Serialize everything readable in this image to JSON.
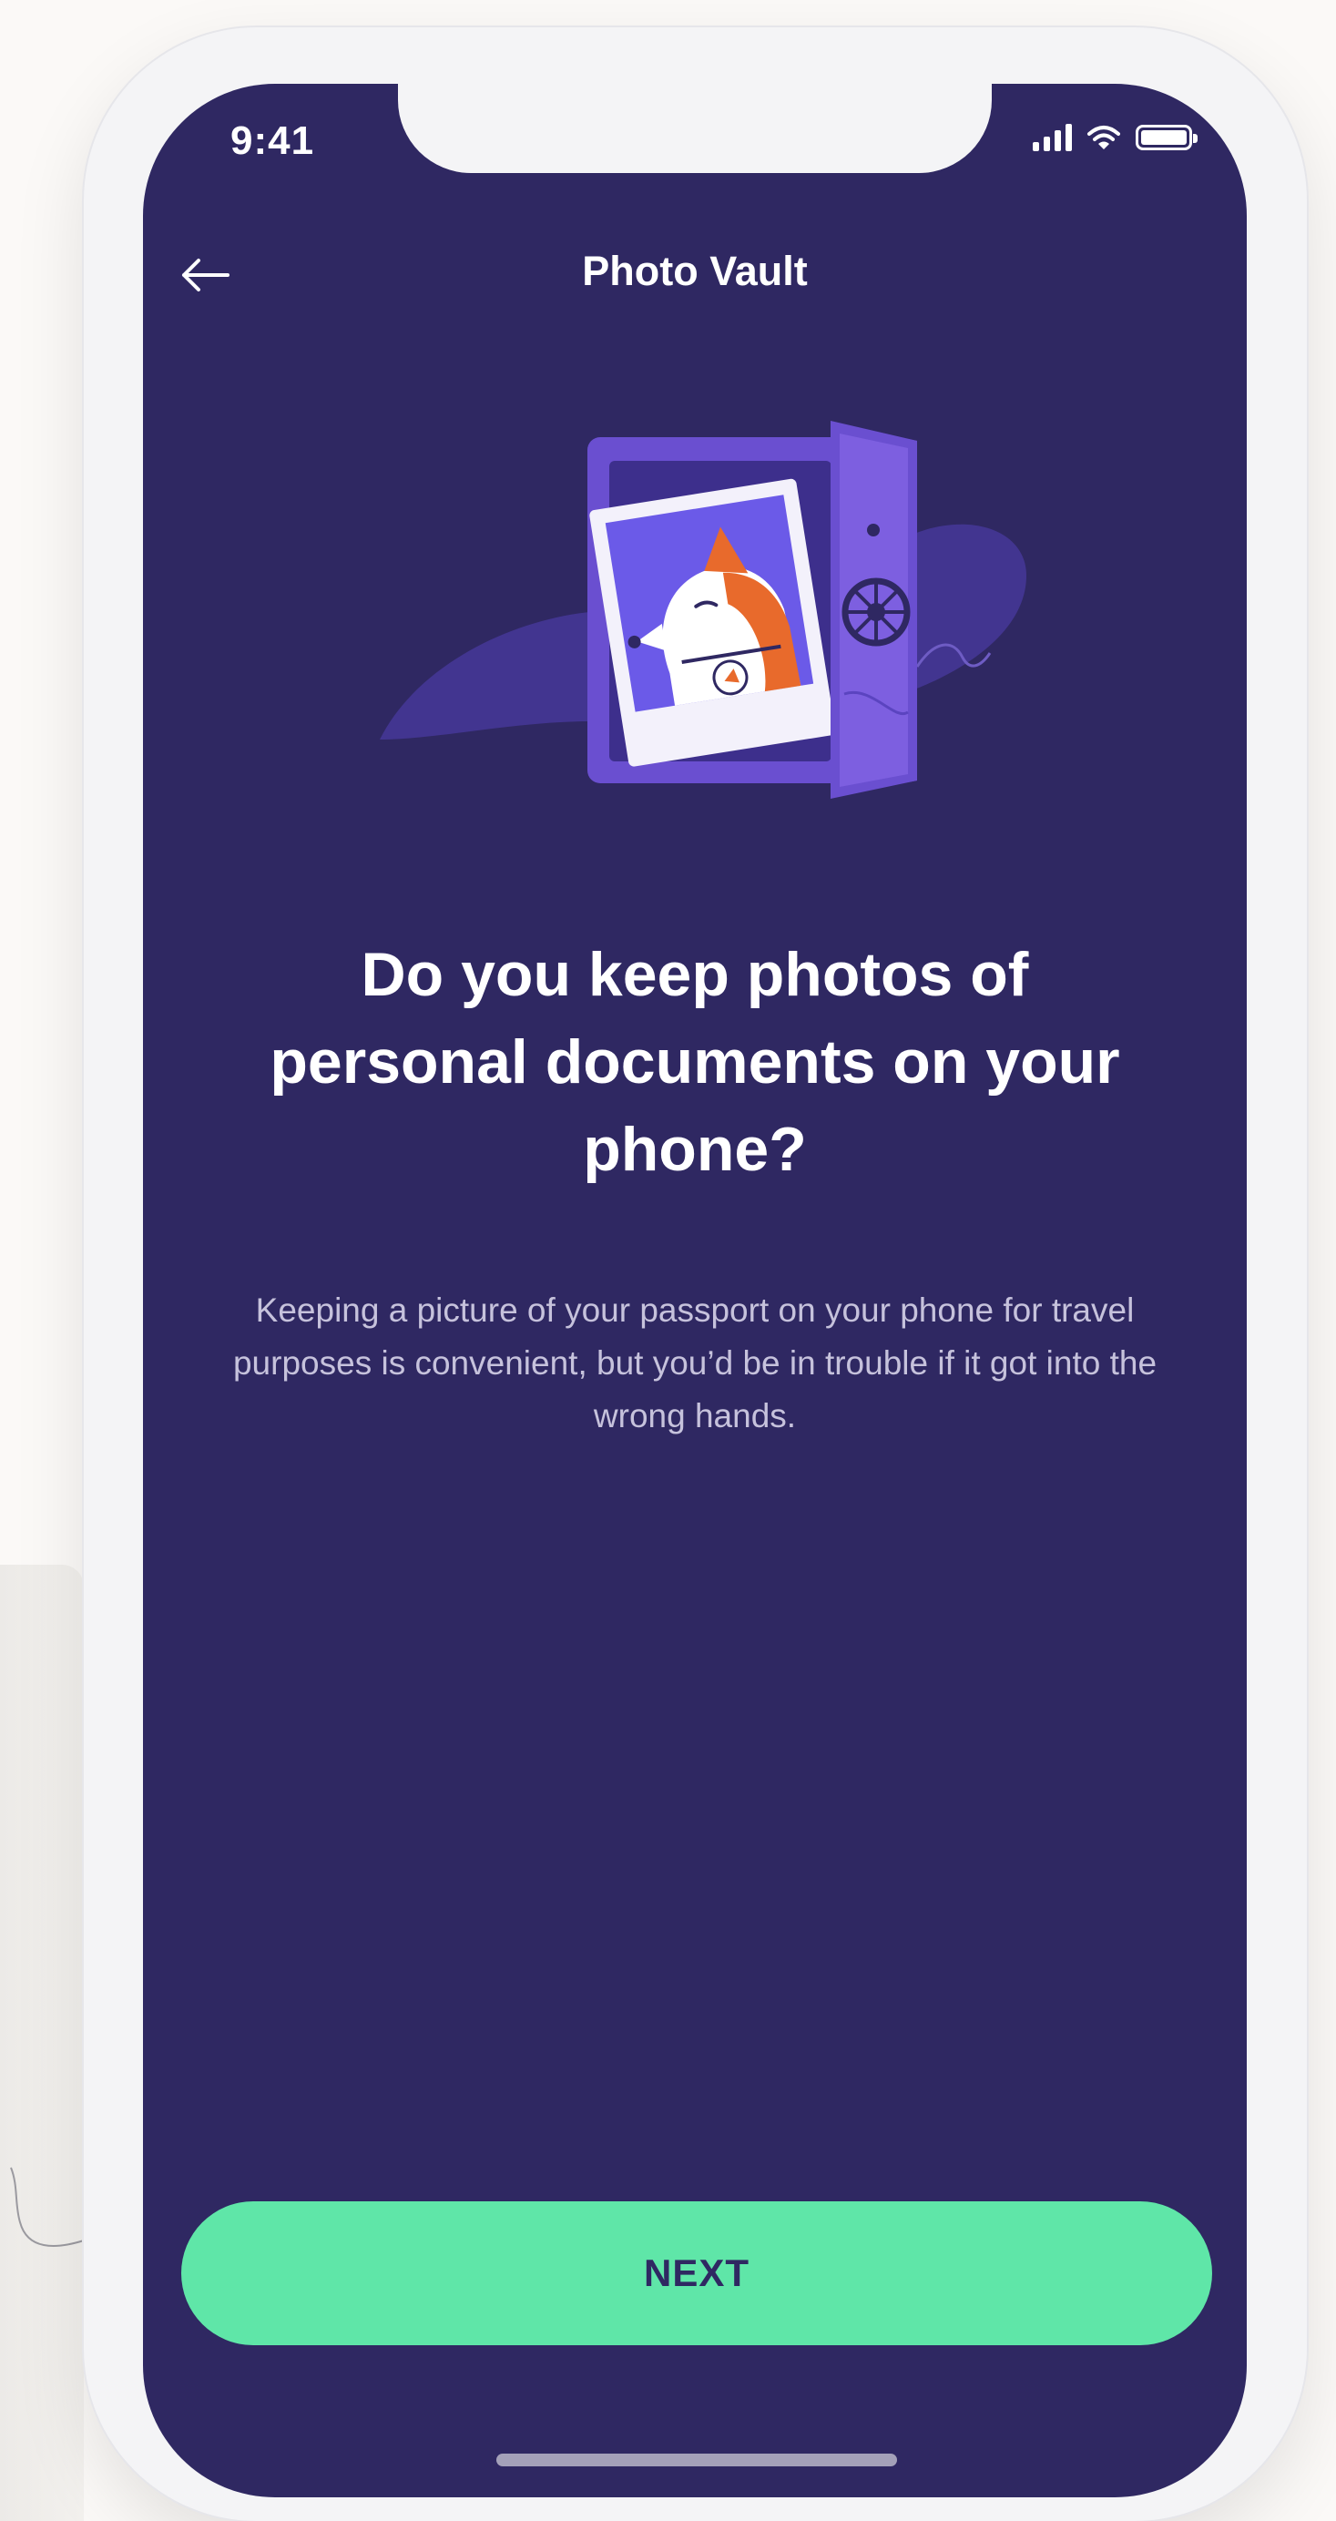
{
  "status_bar": {
    "time": "9:41"
  },
  "header": {
    "title": "Photo Vault",
    "back_icon": "arrow-left-icon"
  },
  "content": {
    "headline": "Do you keep photos of personal documents on your phone?",
    "body": "Keeping a picture of your passport on your phone for travel purposes is convenient, but you’d be in trouble if it got into the wrong hands."
  },
  "footer": {
    "next_label": "NEXT"
  },
  "colors": {
    "screen_background": "#2f2862",
    "accent_button": "#5fe6a8",
    "illustration_purple": "#7d5fe0",
    "illustration_orange": "#e86a2c"
  }
}
